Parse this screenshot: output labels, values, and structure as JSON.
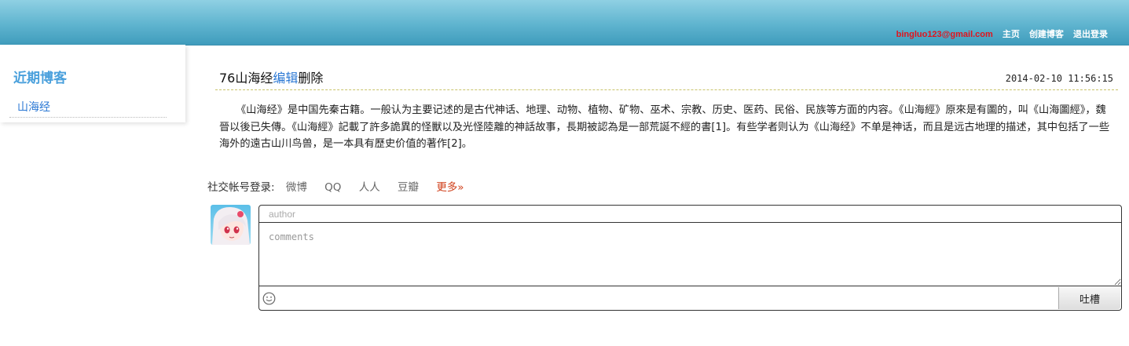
{
  "header": {
    "email": "bingluo123@gmail.com",
    "nav": [
      "主页",
      "创建博客",
      "退出登录"
    ]
  },
  "sidebar": {
    "title": "近期博客",
    "items": [
      {
        "label": "山海经"
      }
    ]
  },
  "post": {
    "title": "76山海经",
    "edit_label": "编辑",
    "delete_label": "删除",
    "date": "2014-02-10 11:56:15",
    "body": "《山海经》是中国先秦古籍。一般认为主要记述的是古代神话、地理、动物、植物、矿物、巫术、宗教、历史、医药、民俗、民族等方面的内容。《山海經》原來是有圖的，叫《山海圖經》，魏晉以後已失傳。《山海經》記載了許多詭異的怪獸以及光怪陸離的神話故事，長期被認為是一部荒誕不經的書[1]。有些学者则认为《山海经》不单是神话，而且是远古地理的描述，其中包括了一些海外的遠古山川鸟兽，是一本具有歷史价值的著作[2]。"
  },
  "social_login": {
    "label": "社交帐号登录:",
    "options": [
      "微博",
      "QQ",
      "人人",
      "豆瓣"
    ],
    "more": "更多»"
  },
  "comment_form": {
    "author_placeholder": "author",
    "comments_placeholder": "comments",
    "submit_label": "吐槽"
  },
  "colors": {
    "header_top": "#8fd0e3",
    "header_bottom": "#3f9cbc",
    "email": "#e0141d",
    "link": "#2b78d4",
    "sidebar_title": "#4aa0dc",
    "more": "#d0401b"
  },
  "icons": {
    "avatar": "anime-girl-avatar",
    "emoji": "smiley-icon"
  }
}
